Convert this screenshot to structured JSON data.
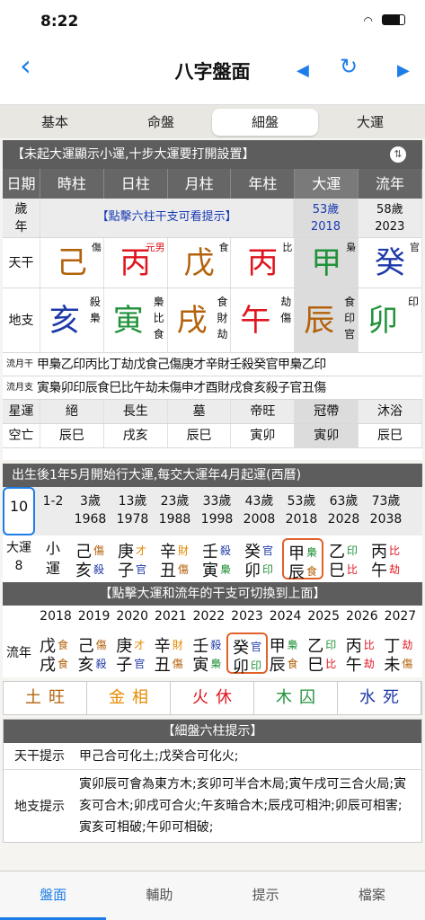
{
  "status": {
    "time": "8:22"
  },
  "nav": {
    "title": "八字盤面",
    "back": "‹",
    "prev": "◀",
    "refresh": "↻",
    "next": "▶"
  },
  "segments": [
    "基本",
    "命盤",
    "細盤",
    "大運"
  ],
  "info_bar": "【未起大運顯示小運,十步大運要打開設置】",
  "columns": [
    "日期",
    "時柱",
    "日柱",
    "月柱",
    "年柱",
    "大運",
    "流年"
  ],
  "age_row": {
    "label1": "歲",
    "label2": "年",
    "hint": "【點擊六柱干支可看提示】",
    "dayun_age": "53歲",
    "dayun_year": "2018",
    "liunian_age": "58歲",
    "liunian_year": "2023"
  },
  "tiangan_label": "天干",
  "dizhi_label": "地支",
  "stems": [
    {
      "c": "己",
      "god": "傷",
      "cls": "c-earth"
    },
    {
      "c": "丙",
      "god": "元男",
      "cls": "c-fire"
    },
    {
      "c": "戊",
      "god": "食",
      "cls": "c-earth"
    },
    {
      "c": "丙",
      "god": "比",
      "cls": "c-fire"
    },
    {
      "c": "甲",
      "god": "梟",
      "cls": "c-wood"
    },
    {
      "c": "癸",
      "god": "官",
      "cls": "c-water"
    }
  ],
  "branches": [
    {
      "c": "亥",
      "h": "殺\n梟",
      "cls": "c-water"
    },
    {
      "c": "寅",
      "h": "梟\n比\n食",
      "cls": "c-wood"
    },
    {
      "c": "戌",
      "h": "食\n財\n劫",
      "cls": "c-earth"
    },
    {
      "c": "午",
      "h": "劫\n傷",
      "cls": "c-fire"
    },
    {
      "c": "辰",
      "h": "食\n印\n官",
      "cls": "c-earth"
    },
    {
      "c": "卯",
      "h": "印",
      "cls": "c-wood"
    }
  ],
  "liuyue_gan": {
    "label": "流月干",
    "items": "甲梟乙印丙比丁劫戊食己傷庚才辛財壬殺癸官甲梟乙印"
  },
  "liuyue_zhi": {
    "label": "流月支",
    "items": "寅梟卯印辰食巳比午劫未傷申才酉財戌食亥殺子官丑傷"
  },
  "xingyun": {
    "label": "星運",
    "vals": [
      "絕",
      "長生",
      "墓",
      "帝旺",
      "冠帶",
      "沐浴"
    ]
  },
  "kongwang": {
    "label": "空亡",
    "vals": [
      "辰巳",
      "戌亥",
      "辰巳",
      "寅卯",
      "寅卯",
      "辰巳"
    ]
  },
  "dayun_hdr": "出生後1年5月開始行大運,每交大運年4月起運(西曆)",
  "dayun_ages": [
    "10",
    "1-2",
    "3歲",
    "13歲",
    "23歲",
    "33歲",
    "43歲",
    "53歲",
    "63歲",
    "73歲"
  ],
  "dayun_years": [
    "",
    "",
    "1968",
    "1978",
    "1988",
    "1998",
    "2008",
    "2018",
    "2028",
    "2038"
  ],
  "dayun_label": "大運",
  "dayun_num": "8",
  "dayun_small": "小\n運",
  "dayun_pillars": [
    [
      "己",
      "傷",
      "亥",
      "殺"
    ],
    [
      "庚",
      "才",
      "子",
      "官"
    ],
    [
      "辛",
      "財",
      "丑",
      "傷"
    ],
    [
      "壬",
      "殺",
      "寅",
      "梟"
    ],
    [
      "癸",
      "官",
      "卯",
      "印"
    ],
    [
      "甲",
      "梟",
      "辰",
      "食"
    ],
    [
      "乙",
      "印",
      "巳",
      "比"
    ],
    [
      "丙",
      "比",
      "午",
      "劫"
    ]
  ],
  "switch_hint": "【點擊大運和流年的干支可切換到上面】",
  "ln_years": [
    "2018",
    "2019",
    "2020",
    "2021",
    "2022",
    "2023",
    "2024",
    "2025",
    "2026",
    "2027"
  ],
  "ln_label": "流年",
  "ln_pillars": [
    [
      "戊",
      "食",
      "戌",
      "食"
    ],
    [
      "己",
      "傷",
      "亥",
      "殺"
    ],
    [
      "庚",
      "才",
      "子",
      "官"
    ],
    [
      "辛",
      "財",
      "丑",
      "傷"
    ],
    [
      "壬",
      "殺",
      "寅",
      "梟"
    ],
    [
      "癸",
      "官",
      "卯",
      "印"
    ],
    [
      "甲",
      "梟",
      "辰",
      "食"
    ],
    [
      "乙",
      "印",
      "巳",
      "比"
    ],
    [
      "丙",
      "比",
      "午",
      "劫"
    ],
    [
      "丁",
      "劫",
      "未",
      "傷"
    ]
  ],
  "wuxing": [
    [
      "土",
      "旺"
    ],
    [
      "金",
      "相"
    ],
    [
      "火",
      "休"
    ],
    [
      "木",
      "囚"
    ],
    [
      "水",
      "死"
    ]
  ],
  "tips_hdr": "【細盤六柱提示】",
  "tips": {
    "gan_label": "天干提示",
    "gan": "甲己合可化土;戊癸合可化火;",
    "zhi_label": "地支提示",
    "zhi": "寅卯辰可會為東方木;亥卯可半合木局;寅午戌可三合火局;寅亥可合木;卯戌可合火;午亥暗合木;辰戌可相沖;卯辰可相害;寅亥可相破;午卯可相破;"
  },
  "tabs": [
    "盤面",
    "輔助",
    "提示",
    "檔案"
  ],
  "colors": {
    "accent": "#1d7de8",
    "header": "#5d5d5d"
  }
}
